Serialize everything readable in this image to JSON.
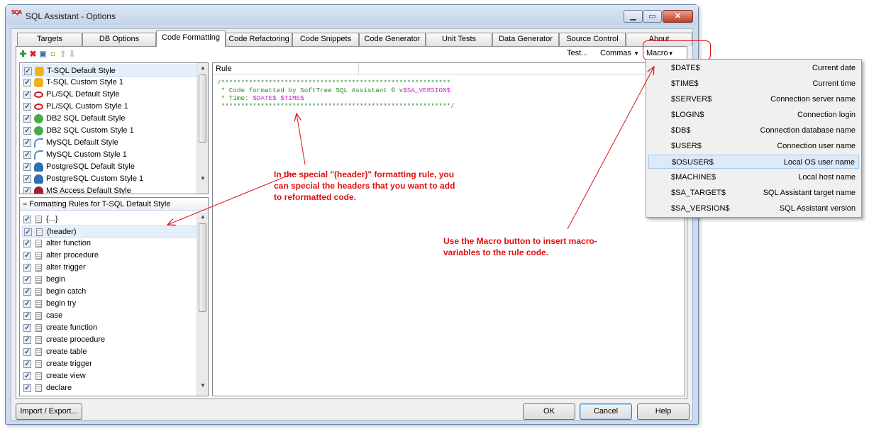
{
  "window": {
    "title": "SQL Assistant - Options",
    "app_icon": "SQA"
  },
  "tabs": [
    "Targets",
    "DB Options",
    "Code Formatting",
    "Code Refactoring",
    "Code Snippets",
    "Code Generator",
    "Unit Tests",
    "Data Generator",
    "Source Control",
    "About"
  ],
  "toolbar": {
    "test": "Test...",
    "commas": "Commas",
    "macro": "Macro"
  },
  "styles": [
    {
      "name": "T-SQL Default Style",
      "icon": "database-cylinder-icon",
      "color": "#f2b01e"
    },
    {
      "name": "T-SQL Custom Style 1",
      "icon": "database-cylinder-icon",
      "color": "#f2b01e"
    },
    {
      "name": "PL/SQL Default Style",
      "icon": "oracle-ring-icon",
      "color": "#d01818"
    },
    {
      "name": "PL/SQL Custom Style 1",
      "icon": "oracle-ring-icon",
      "color": "#d01818"
    },
    {
      "name": "DB2 SQL Default Style",
      "icon": "db2-icon",
      "color": "#4ca84c"
    },
    {
      "name": "DB2 SQL Custom Style 1",
      "icon": "db2-icon",
      "color": "#4ca84c"
    },
    {
      "name": "MySQL Default Style",
      "icon": "mysql-dolphin-icon",
      "color": "#5a8fc0"
    },
    {
      "name": "MySQL Custom Style 1",
      "icon": "mysql-dolphin-icon",
      "color": "#5a8fc0"
    },
    {
      "name": "PostgreSQL Default Style",
      "icon": "postgres-elephant-icon",
      "color": "#2d6fb5"
    },
    {
      "name": "PostgreSQL Custom Style 1",
      "icon": "postgres-elephant-icon",
      "color": "#2d6fb5"
    },
    {
      "name": "MS Access Default Style",
      "icon": "access-icon",
      "color": "#a02030"
    }
  ],
  "rules_header": "Formatting Rules for T-SQL Default Style",
  "rules": [
    "{...}",
    "(header)",
    "alter function",
    "alter procedure",
    "alter trigger",
    "begin",
    "begin catch",
    "begin try",
    "case",
    "create function",
    "create procedure",
    "create table",
    "create trigger",
    "create view",
    "declare"
  ],
  "rule_column": "Rule",
  "code": {
    "line1": "/**********************************************************",
    "line2_a": " * Code formatted by SoftTree SQL Assistant © v",
    "line2_b": "$SA_VERSION$",
    "line3_a": " * Time: ",
    "line3_b": "$DATE$ $TIME$",
    "line4": " **********************************************************/"
  },
  "macros": [
    {
      "key": "$DATE$",
      "desc": "Current date"
    },
    {
      "key": "$TIME$",
      "desc": "Current time"
    },
    {
      "key": "$SERVER$",
      "desc": "Connection server name"
    },
    {
      "key": "$LOGIN$",
      "desc": "Connection login"
    },
    {
      "key": "$DB$",
      "desc": "Connection database name"
    },
    {
      "key": "$USER$",
      "desc": "Connection user name"
    },
    {
      "key": "$OSUSER$",
      "desc": "Local OS user name"
    },
    {
      "key": "$MACHINE$",
      "desc": "Local host name"
    },
    {
      "key": "$SA_TARGET$",
      "desc": "SQL Assistant target name"
    },
    {
      "key": "$SA_VERSION$",
      "desc": "SQL Assistant version"
    }
  ],
  "buttons": {
    "import": "Import / Export...",
    "ok": "OK",
    "cancel": "Cancel",
    "help": "Help"
  },
  "annotations": {
    "header_note": [
      "In the special \"(header)\" formatting rule, you",
      "can special the headers that you want to add",
      "to reformatted code."
    ],
    "macro_note": [
      "Use the Macro button to insert macro-",
      "variables to the rule code."
    ]
  }
}
